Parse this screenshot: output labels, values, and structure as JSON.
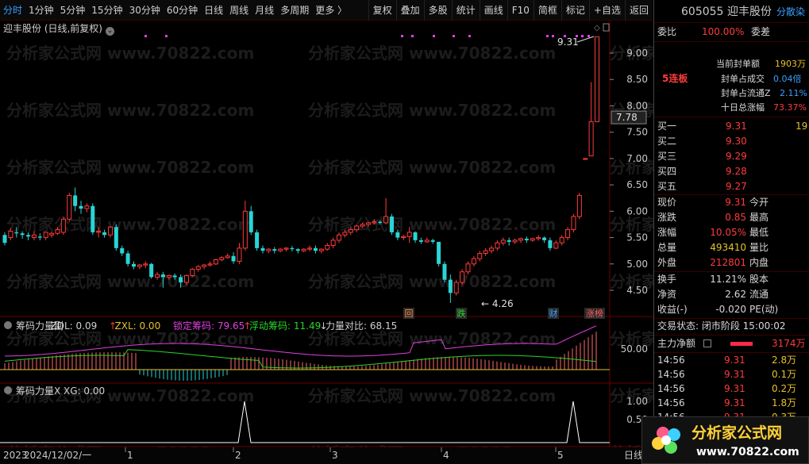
{
  "toolbar": {
    "periods": [
      "分时",
      "1分钟",
      "5分钟",
      "15分钟",
      "30分钟",
      "60分钟",
      "日线",
      "周线",
      "月线",
      "多周期",
      "更多 〉"
    ],
    "active_period": "分时",
    "buttons": [
      "复权",
      "叠加",
      "多股",
      "统计",
      "画线",
      "F10",
      "简框",
      "标记",
      "+自选",
      "返回"
    ]
  },
  "chart": {
    "title": "迎丰股份 (日线,前复权)",
    "title_icon": "chevron-down-icon",
    "price_labels": [
      "9.00",
      "8.50",
      "8.00",
      "7.50",
      "7.00",
      "6.50",
      "6.00",
      "5.50",
      "5.00",
      "4.50"
    ],
    "current_price_tag": "7.78",
    "high_label": "9.31",
    "low_label": "4.26",
    "events": [
      "回",
      "跌",
      "财",
      "涨榜"
    ],
    "watermark": "分析家公式网 www.70822.com"
  },
  "indicator1": {
    "name": "筹码力量副",
    "zdl": "ZDL: 0.09",
    "zxl": "ZXL: 0.00",
    "locked": "锁定筹码: 79.65",
    "floating": "浮动筹码: 11.49",
    "ratio": "力量对比: 68.15",
    "axis_label": "50.00"
  },
  "indicator2": {
    "name": "筹码力量X",
    "xg": "XG: 0.00",
    "axis_labels": [
      "1.00",
      "0.50"
    ]
  },
  "time_axis": {
    "labels": [
      "2023",
      "2024/12/02/一",
      "1",
      "2",
      "3",
      "4",
      "5"
    ],
    "period_label": "日线"
  },
  "quote": {
    "code": "605055",
    "name": "迎丰股份",
    "tag": "分散染",
    "webi_label": "委比",
    "webi_value": "100.00%",
    "weicha_label": "委差",
    "limit_days": "5连板",
    "seal_amount_label": "当前封单额",
    "seal_amount_value": "1903万",
    "seal_trade_label": "封单占成交",
    "seal_trade_value": "0.04倍",
    "seal_float_label": "封单占流通Z",
    "seal_float_value": "2.11%",
    "ten_day_label": "十日总涨幅",
    "ten_day_value": "73.37%",
    "bids": [
      {
        "label": "买一",
        "price": "9.31",
        "vol": "19"
      },
      {
        "label": "买二",
        "price": "9.30",
        "vol": ""
      },
      {
        "label": "买三",
        "price": "9.29",
        "vol": ""
      },
      {
        "label": "买四",
        "price": "9.28",
        "vol": ""
      },
      {
        "label": "买五",
        "price": "9.27",
        "vol": ""
      }
    ],
    "stats": [
      {
        "l1": "现价",
        "v1": "9.31",
        "l2": "今开",
        "c": "red"
      },
      {
        "l1": "涨跌",
        "v1": "0.85",
        "l2": "最高",
        "c": "red"
      },
      {
        "l1": "涨幅",
        "v1": "10.05%",
        "l2": "最低",
        "c": "red"
      },
      {
        "l1": "总量",
        "v1": "493410",
        "l2": "量比",
        "c": "yellow"
      },
      {
        "l1": "外盘",
        "v1": "212801",
        "l2": "内盘",
        "c": "red"
      }
    ],
    "stats2": [
      {
        "l1": "换手",
        "v1": "11.21%",
        "l2": "股本"
      },
      {
        "l1": "净资",
        "v1": "2.62",
        "l2": "流通"
      },
      {
        "l1": "收益(-)",
        "v1": "-0.020",
        "l2": "PE(动)"
      }
    ],
    "trade_status": "交易状态: 闭市阶段 15:00:02",
    "main_flow_label": "主力净额",
    "main_flow_value": "3174万",
    "ticks": [
      {
        "time": "14:56",
        "price": "9.31",
        "vol": "2.8万"
      },
      {
        "time": "14:56",
        "price": "9.31",
        "vol": "0.1万"
      },
      {
        "time": "14:56",
        "price": "9.31",
        "vol": "0.2万"
      },
      {
        "time": "14:56",
        "price": "9.31",
        "vol": "1.8万"
      },
      {
        "time": "14:56",
        "price": "9.31",
        "vol": "0.3万"
      }
    ]
  },
  "logo": {
    "title": "分析家公式网",
    "url": "www.70822.com"
  },
  "colors": {
    "up": "#ff3b3b",
    "down": "#2ad4d4",
    "magenta": "#e040e0",
    "green_line": "#2ad42a",
    "yellow": "#e6c22a"
  }
}
